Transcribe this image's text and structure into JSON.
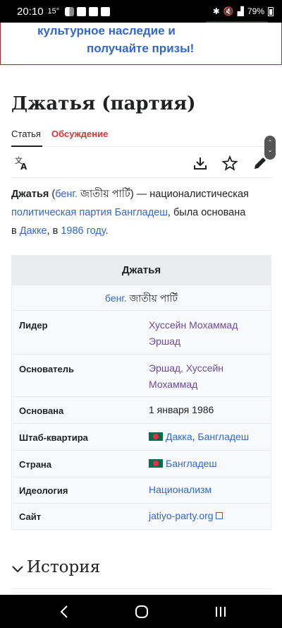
{
  "status": {
    "time": "20:10",
    "temp": "15°",
    "battery": "79%"
  },
  "banner": {
    "line1": "культурное наследие и",
    "line2": "получайте призы!"
  },
  "page": {
    "title": "Джатья (партия)"
  },
  "tabs": {
    "article": "Статья",
    "talk": "Обсуждение"
  },
  "lead": {
    "term": "Джатья",
    "lang_abbr": "бенг.",
    "native": "জাতীয় পার্টি",
    "t1": "— националистическая",
    "link_party": "политическая партия Бангладеш",
    "t2": ", была основана",
    "t3": "в",
    "link_city": "Дакке",
    "t4": ", в",
    "link_year": "1986 году",
    "t5": "."
  },
  "infobox": {
    "title": "Джатья",
    "sub_lang": "бенг.",
    "sub_native": "জাতীয় পার্টি",
    "rows": [
      {
        "key": "Лидер",
        "value": "Хуссейн Мохаммад Эршад"
      },
      {
        "key": "Основатель",
        "value": "Эршад, Хуссейн Мохаммад"
      },
      {
        "key": "Основана",
        "value": "1 января 1986"
      },
      {
        "key": "Штаб-квартира",
        "city": "Дакка",
        "sep": ", ",
        "country": "Бангладеш"
      },
      {
        "key": "Страна",
        "value": "Бангладеш"
      },
      {
        "key": "Идеология",
        "value": "Национализм"
      },
      {
        "key": "Сайт",
        "value": "jatiyo-party.org"
      }
    ]
  },
  "section": {
    "heading": "История"
  },
  "colors": {
    "link": "#3366cc",
    "visited": "#6b4ba1",
    "talk": "#dd3333",
    "banner_border": "#b32424"
  },
  "icons": [
    "language-icon",
    "download-icon",
    "star-icon",
    "edit-icon",
    "chevron-down-icon",
    "back-icon",
    "home-icon",
    "recents-icon"
  ]
}
